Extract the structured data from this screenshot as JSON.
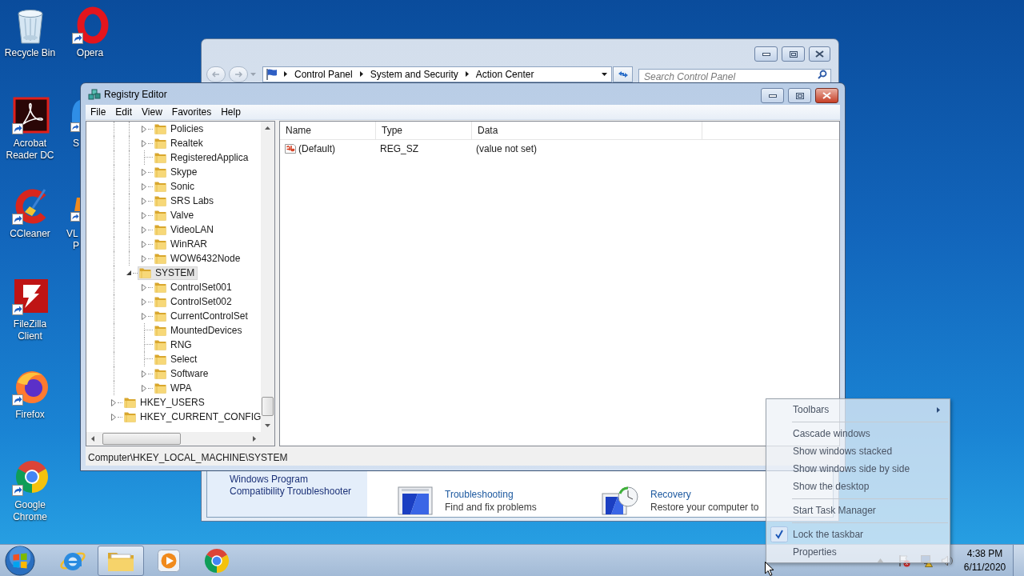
{
  "desktop_icons": [
    {
      "kind": "recycle_bin",
      "label": "Recycle Bin"
    },
    {
      "kind": "acrobat",
      "label": "Acrobat Reader DC"
    },
    {
      "kind": "ccleaner",
      "label": "CCleaner"
    },
    {
      "kind": "filezilla",
      "label": "FileZilla Client"
    },
    {
      "kind": "firefox",
      "label": "Firefox"
    },
    {
      "kind": "chrome",
      "label": "Google Chrome"
    },
    {
      "kind": "opera",
      "label": "Opera"
    },
    {
      "kind": "cut_blue",
      "label": "S"
    },
    {
      "kind": "cut_cone",
      "label": "VL",
      "label_line_2": "P"
    }
  ],
  "control_panel": {
    "active": false,
    "breadcrumb": [
      "Control Panel",
      "System and Security",
      "Action Center"
    ],
    "search": {
      "placeholder": "Search Control Panel"
    },
    "sidebar_link": "Windows Program Compatibility Troubleshooter",
    "items": [
      {
        "kind": "troubleshooting",
        "title": "Troubleshooting",
        "description": "Find and fix problems"
      },
      {
        "kind": "recovery",
        "title": "Recovery",
        "description": "Restore your computer to"
      }
    ]
  },
  "registry_editor": {
    "active": true,
    "title": "Registry Editor",
    "menu": [
      "File",
      "Edit",
      "View",
      "Favorites",
      "Help"
    ],
    "tree": [
      {
        "children": [
          {
            "children": [
              {
                "children": [
                  {
                    "label": "Policies",
                    "kind": "branch",
                    "expanded": false,
                    "selected": false
                  },
                  {
                    "label": "Realtek",
                    "kind": "branch",
                    "expanded": false,
                    "selected": false
                  },
                  {
                    "label": "RegisteredApplica",
                    "kind": "leaf",
                    "selected": false
                  },
                  {
                    "label": "Skype",
                    "kind": "branch",
                    "expanded": false,
                    "selected": false
                  },
                  {
                    "label": "Sonic",
                    "kind": "branch",
                    "expanded": false,
                    "selected": false
                  },
                  {
                    "label": "SRS Labs",
                    "kind": "branch",
                    "expanded": false,
                    "selected": false
                  },
                  {
                    "label": "Valve",
                    "kind": "branch",
                    "expanded": false,
                    "selected": false
                  },
                  {
                    "label": "VideoLAN",
                    "kind": "branch",
                    "expanded": false,
                    "selected": false
                  },
                  {
                    "label": "WinRAR",
                    "kind": "branch",
                    "expanded": false,
                    "selected": false
                  },
                  {
                    "label": "WOW6432Node",
                    "kind": "branch",
                    "expanded": false,
                    "selected": false
                  }
                ]
              },
              {
                "label": "SYSTEM",
                "kind": "branch",
                "expanded": true,
                "selected": true,
                "children": [
                  {
                    "label": "ControlSet001",
                    "kind": "branch",
                    "expanded": false,
                    "selected": false
                  },
                  {
                    "label": "ControlSet002",
                    "kind": "branch",
                    "expanded": false,
                    "selected": false
                  },
                  {
                    "label": "CurrentControlSet",
                    "kind": "branch",
                    "expanded": false,
                    "selected": false
                  },
                  {
                    "label": "MountedDevices",
                    "kind": "leaf",
                    "selected": false
                  },
                  {
                    "label": "RNG",
                    "kind": "leaf",
                    "selected": false
                  },
                  {
                    "label": "Select",
                    "kind": "leaf",
                    "selected": false
                  },
                  {
                    "label": "Software",
                    "kind": "branch",
                    "expanded": false,
                    "selected": false
                  },
                  {
                    "label": "WPA",
                    "kind": "branch",
                    "expanded": false,
                    "selected": false
                  }
                ]
              }
            ]
          },
          {
            "label": "HKEY_USERS",
            "kind": "branch",
            "expanded": false,
            "selected": false
          },
          {
            "label": "HKEY_CURRENT_CONFIG",
            "kind": "branch",
            "expanded": false,
            "selected": false
          }
        ]
      }
    ],
    "columns": [
      "Name",
      "Type",
      "Data"
    ],
    "rows": [
      {
        "name": "(Default)",
        "type": "REG_SZ",
        "data": "(value not set)"
      }
    ],
    "status_bar": "Computer\\HKEY_LOCAL_MACHINE\\SYSTEM"
  },
  "context_menu": {
    "items": [
      {
        "kind": "submenu",
        "label": "Toolbars"
      },
      {
        "kind": "separator"
      },
      {
        "kind": "command",
        "label": "Cascade windows"
      },
      {
        "kind": "command",
        "label": "Show windows stacked"
      },
      {
        "kind": "command",
        "label": "Show windows side by side"
      },
      {
        "kind": "command",
        "label": "Show the desktop"
      },
      {
        "kind": "separator"
      },
      {
        "kind": "command",
        "label": "Start Task Manager"
      },
      {
        "kind": "separator"
      },
      {
        "kind": "check",
        "label": "Lock the taskbar",
        "checked": true
      },
      {
        "kind": "command",
        "label": "Properties"
      }
    ]
  },
  "taskbar": {
    "apps": [
      {
        "kind": "ie",
        "running": false
      },
      {
        "kind": "explorer",
        "running": true
      },
      {
        "kind": "media_player",
        "running": false
      },
      {
        "kind": "chrome",
        "running": false
      }
    ],
    "clock": {
      "time": "4:38 PM",
      "date": "6/11/2020"
    }
  }
}
